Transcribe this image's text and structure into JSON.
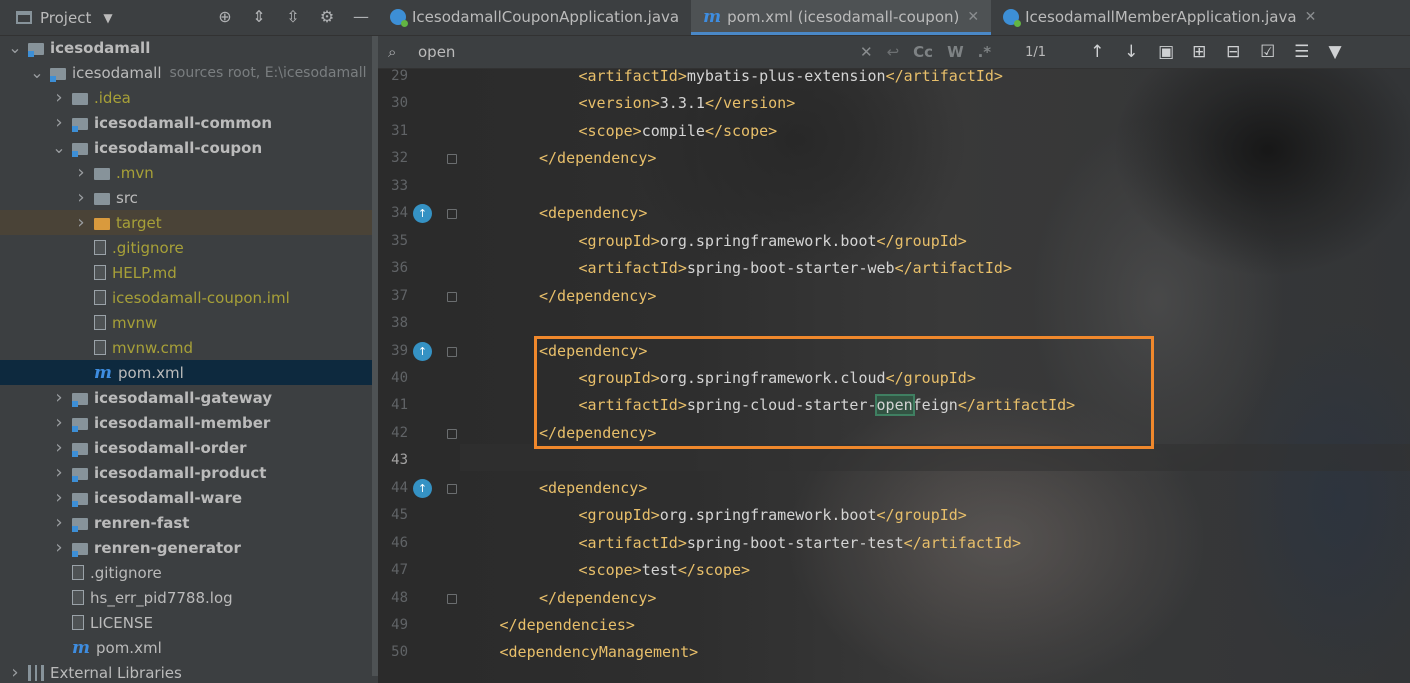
{
  "project_panel": {
    "title": "Project",
    "tree": [
      {
        "label": "icesodamall",
        "indent": 0,
        "arrow": "down",
        "icon": "module-folder",
        "bold": true
      },
      {
        "label": "icesodamall",
        "note": "sources root,  E:\\icesodamall",
        "indent": 1,
        "arrow": "down",
        "icon": "module-folder"
      },
      {
        "label": ".idea",
        "indent": 2,
        "arrow": "right",
        "icon": "folder",
        "color": "olive"
      },
      {
        "label": "icesodamall-common",
        "indent": 2,
        "arrow": "right",
        "icon": "module-folder",
        "bold": true
      },
      {
        "label": "icesodamall-coupon",
        "indent": 2,
        "arrow": "down",
        "icon": "module-folder",
        "bold": true
      },
      {
        "label": ".mvn",
        "indent": 3,
        "arrow": "right",
        "icon": "folder",
        "color": "olive"
      },
      {
        "label": "src",
        "indent": 3,
        "arrow": "right",
        "icon": "folder"
      },
      {
        "label": "target",
        "indent": 3,
        "arrow": "right",
        "icon": "folder-orange",
        "color": "olive",
        "excluded": true
      },
      {
        "label": ".gitignore",
        "indent": 3,
        "arrow": "none",
        "icon": "file",
        "color": "olive"
      },
      {
        "label": "HELP.md",
        "indent": 3,
        "arrow": "none",
        "icon": "file",
        "color": "olive"
      },
      {
        "label": "icesodamall-coupon.iml",
        "indent": 3,
        "arrow": "none",
        "icon": "file",
        "color": "olive"
      },
      {
        "label": "mvnw",
        "indent": 3,
        "arrow": "none",
        "icon": "file",
        "color": "olive"
      },
      {
        "label": "mvnw.cmd",
        "indent": 3,
        "arrow": "none",
        "icon": "file",
        "color": "olive"
      },
      {
        "label": "pom.xml",
        "indent": 3,
        "arrow": "none",
        "icon": "maven",
        "selected": true
      },
      {
        "label": "icesodamall-gateway",
        "indent": 2,
        "arrow": "right",
        "icon": "module-folder",
        "bold": true
      },
      {
        "label": "icesodamall-member",
        "indent": 2,
        "arrow": "right",
        "icon": "module-folder",
        "bold": true
      },
      {
        "label": "icesodamall-order",
        "indent": 2,
        "arrow": "right",
        "icon": "module-folder",
        "bold": true
      },
      {
        "label": "icesodamall-product",
        "indent": 2,
        "arrow": "right",
        "icon": "module-folder",
        "bold": true
      },
      {
        "label": "icesodamall-ware",
        "indent": 2,
        "arrow": "right",
        "icon": "module-folder",
        "bold": true
      },
      {
        "label": "renren-fast",
        "indent": 2,
        "arrow": "right",
        "icon": "module-folder",
        "bold": true
      },
      {
        "label": "renren-generator",
        "indent": 2,
        "arrow": "right",
        "icon": "module-folder",
        "bold": true
      },
      {
        "label": ".gitignore",
        "indent": 2,
        "arrow": "none",
        "icon": "file"
      },
      {
        "label": "hs_err_pid7788.log",
        "indent": 2,
        "arrow": "none",
        "icon": "file"
      },
      {
        "label": "LICENSE",
        "indent": 2,
        "arrow": "none",
        "icon": "file"
      },
      {
        "label": "pom.xml",
        "indent": 2,
        "arrow": "none",
        "icon": "maven"
      },
      {
        "label": "External Libraries",
        "indent": 0,
        "arrow": "right",
        "icon": "libraries"
      }
    ]
  },
  "tabs": [
    {
      "label": "IcesodamallCouponApplication.java",
      "icon": "java-class-icon",
      "closable": false,
      "active": false
    },
    {
      "label": "pom.xml (icesodamall-coupon)",
      "icon": "maven-icon",
      "closable": true,
      "active": true
    },
    {
      "label": "IcesodamallMemberApplication.java",
      "icon": "java-class-icon",
      "closable": true,
      "active": false
    }
  ],
  "search": {
    "query": "open",
    "match_count": "1/1",
    "case_label": "Cc",
    "words_label": "W",
    "regex_label": ".*"
  },
  "editor": {
    "current_line": 43,
    "lines": [
      {
        "n": 29,
        "indent": 3,
        "tokens": [
          {
            "t": "tag",
            "v": "<artifactId>"
          },
          {
            "t": "txt",
            "v": "mybatis-plus-extension"
          },
          {
            "t": "tag",
            "v": "</artifactId>"
          }
        ]
      },
      {
        "n": 30,
        "indent": 3,
        "tokens": [
          {
            "t": "tag",
            "v": "<version>"
          },
          {
            "t": "txt",
            "v": "3.3.1"
          },
          {
            "t": "tag",
            "v": "</version>"
          }
        ]
      },
      {
        "n": 31,
        "indent": 3,
        "tokens": [
          {
            "t": "tag",
            "v": "<scope>"
          },
          {
            "t": "txt",
            "v": "compile"
          },
          {
            "t": "tag",
            "v": "</scope>"
          }
        ]
      },
      {
        "n": 32,
        "indent": 2,
        "tokens": [
          {
            "t": "tag",
            "v": "</dependency>"
          }
        ]
      },
      {
        "n": 33,
        "indent": 0,
        "tokens": []
      },
      {
        "n": 34,
        "indent": 2,
        "mark": true,
        "tokens": [
          {
            "t": "tag",
            "v": "<dependency>"
          }
        ]
      },
      {
        "n": 35,
        "indent": 3,
        "tokens": [
          {
            "t": "tag",
            "v": "<groupId>"
          },
          {
            "t": "txt",
            "v": "org.springframework.boot"
          },
          {
            "t": "tag",
            "v": "</groupId>"
          }
        ]
      },
      {
        "n": 36,
        "indent": 3,
        "tokens": [
          {
            "t": "tag",
            "v": "<artifactId>"
          },
          {
            "t": "txt",
            "v": "spring-boot-starter-web"
          },
          {
            "t": "tag",
            "v": "</artifactId>"
          }
        ]
      },
      {
        "n": 37,
        "indent": 2,
        "tokens": [
          {
            "t": "tag",
            "v": "</dependency>"
          }
        ]
      },
      {
        "n": 38,
        "indent": 0,
        "tokens": []
      },
      {
        "n": 39,
        "indent": 2,
        "mark": true,
        "tokens": [
          {
            "t": "tag",
            "v": "<dependency>"
          }
        ]
      },
      {
        "n": 40,
        "indent": 3,
        "tokens": [
          {
            "t": "tag",
            "v": "<groupId>"
          },
          {
            "t": "txt",
            "v": "org.springframework.cloud"
          },
          {
            "t": "tag",
            "v": "</groupId>"
          }
        ]
      },
      {
        "n": 41,
        "indent": 3,
        "tokens": [
          {
            "t": "tag",
            "v": "<artifactId>"
          },
          {
            "t": "txt",
            "v": "spring-cloud-starter-"
          },
          {
            "t": "match",
            "v": "open"
          },
          {
            "t": "txt",
            "v": "feign"
          },
          {
            "t": "tag",
            "v": "</artifactId>"
          }
        ]
      },
      {
        "n": 42,
        "indent": 2,
        "tokens": [
          {
            "t": "tag",
            "v": "</dependency>"
          }
        ]
      },
      {
        "n": 43,
        "indent": 0,
        "tokens": []
      },
      {
        "n": 44,
        "indent": 2,
        "mark": true,
        "tokens": [
          {
            "t": "tag",
            "v": "<dependency>"
          }
        ]
      },
      {
        "n": 45,
        "indent": 3,
        "tokens": [
          {
            "t": "tag",
            "v": "<groupId>"
          },
          {
            "t": "txt",
            "v": "org.springframework.boot"
          },
          {
            "t": "tag",
            "v": "</groupId>"
          }
        ]
      },
      {
        "n": 46,
        "indent": 3,
        "tokens": [
          {
            "t": "tag",
            "v": "<artifactId>"
          },
          {
            "t": "txt",
            "v": "spring-boot-starter-test"
          },
          {
            "t": "tag",
            "v": "</artifactId>"
          }
        ]
      },
      {
        "n": 47,
        "indent": 3,
        "tokens": [
          {
            "t": "tag",
            "v": "<scope>"
          },
          {
            "t": "txt",
            "v": "test"
          },
          {
            "t": "tag",
            "v": "</scope>"
          }
        ]
      },
      {
        "n": 48,
        "indent": 2,
        "tokens": [
          {
            "t": "tag",
            "v": "</dependency>"
          }
        ]
      },
      {
        "n": 49,
        "indent": 1,
        "tokens": [
          {
            "t": "tag",
            "v": "</dependencies>"
          }
        ]
      },
      {
        "n": 50,
        "indent": 1,
        "tokens": [
          {
            "t": "tag",
            "v": "<dependencyManagement>"
          }
        ]
      }
    ]
  },
  "colors": {
    "panel_bg": "#3c3f41",
    "editor_bg": "#2b2b2b",
    "xml_tag": "#e8bf6a",
    "text": "#d4d4d4",
    "selection": "#0d293e",
    "highlight_box": "#f0882c",
    "accent": "#4a88c7"
  }
}
